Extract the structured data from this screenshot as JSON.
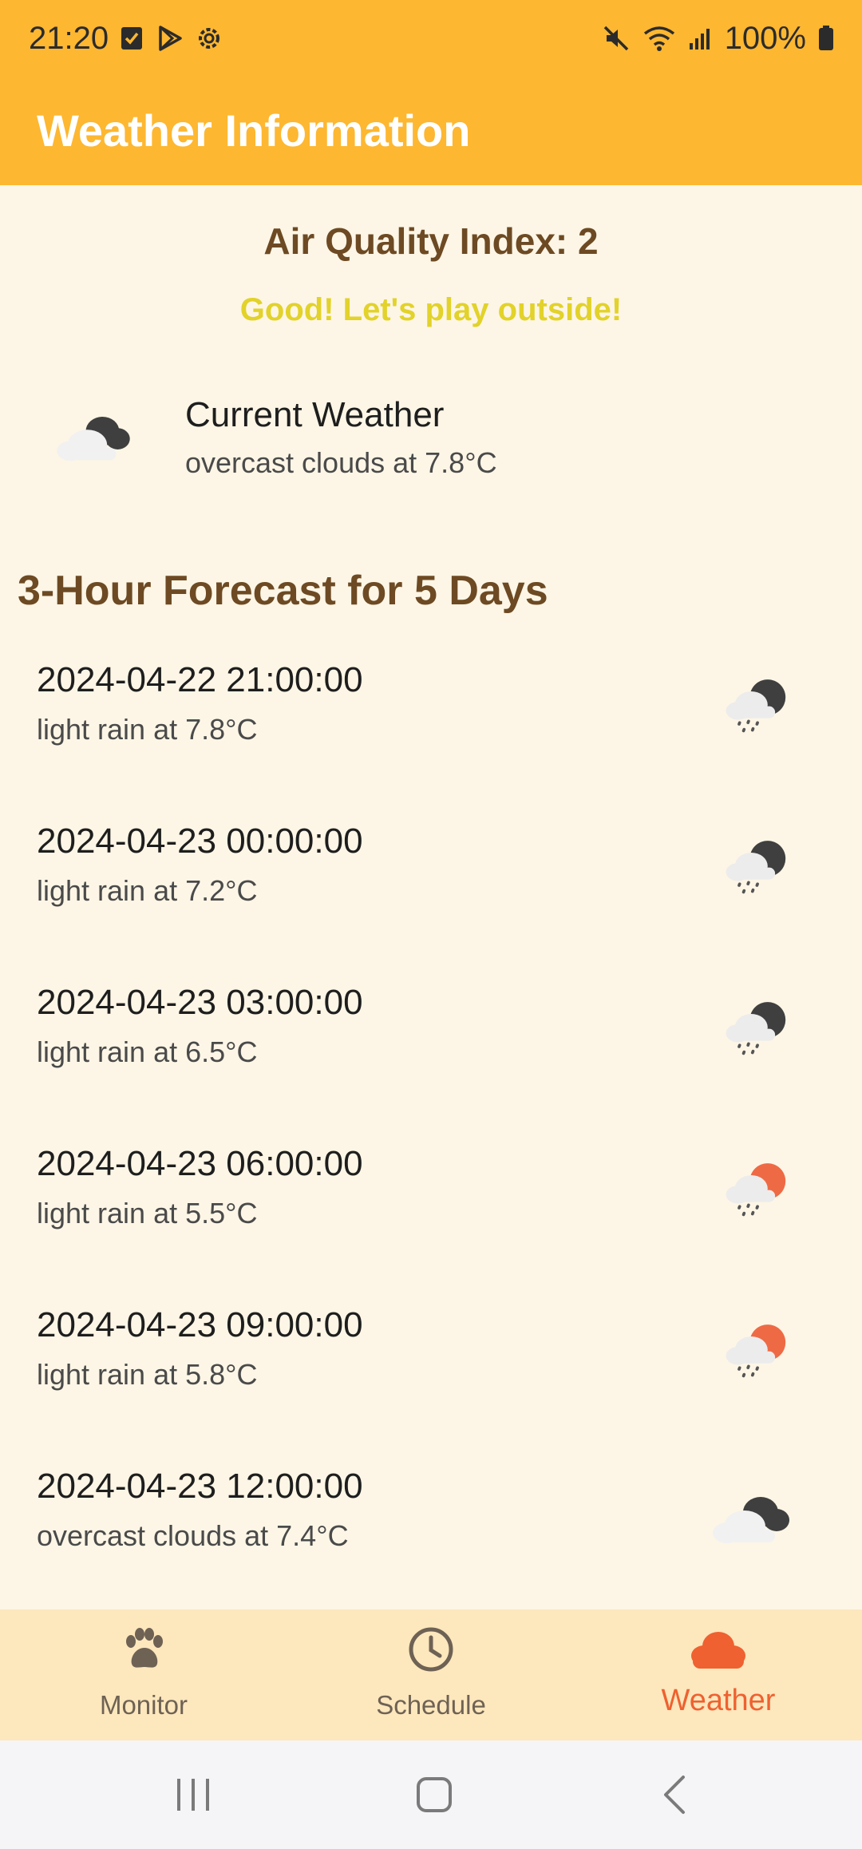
{
  "status_bar": {
    "time": "21:20",
    "battery_text": "100%",
    "left_icons": [
      "checkbox-icon",
      "play-store-icon",
      "settings-gear-icon"
    ],
    "right_icons": [
      "mute-icon",
      "wifi-icon",
      "signal-icon",
      "battery-icon"
    ]
  },
  "app_bar": {
    "title": "Weather Information"
  },
  "air_quality": {
    "title": "Air Quality Index: 2",
    "message": "Good! Let's play outside!"
  },
  "current_weather": {
    "title": "Current Weather",
    "description": "overcast clouds at 7.8°C",
    "icon": "overcast-clouds-icon"
  },
  "forecast": {
    "heading": "3-Hour Forecast for 5 Days",
    "items": [
      {
        "time": "2024-04-22 21:00:00",
        "description": "light rain at 7.8°C",
        "icon": "light-rain-night-icon"
      },
      {
        "time": "2024-04-23 00:00:00",
        "description": "light rain at 7.2°C",
        "icon": "light-rain-night-icon"
      },
      {
        "time": "2024-04-23 03:00:00",
        "description": "light rain at 6.5°C",
        "icon": "light-rain-night-icon"
      },
      {
        "time": "2024-04-23 06:00:00",
        "description": "light rain at 5.5°C",
        "icon": "light-rain-day-icon"
      },
      {
        "time": "2024-04-23 09:00:00",
        "description": "light rain at 5.8°C",
        "icon": "light-rain-day-icon"
      },
      {
        "time": "2024-04-23 12:00:00",
        "description": "overcast clouds at 7.4°C",
        "icon": "overcast-clouds-icon"
      }
    ]
  },
  "bottom_nav": {
    "items": [
      {
        "label": "Monitor",
        "icon": "paw-icon",
        "active": false
      },
      {
        "label": "Schedule",
        "icon": "clock-icon",
        "active": false
      },
      {
        "label": "Weather",
        "icon": "cloud-icon",
        "active": true
      }
    ]
  },
  "colors": {
    "app_bar": "#fdb731",
    "background": "#fdf6e6",
    "heading_brown": "#6d4a23",
    "good_yellow": "#e2d22a",
    "nav_background": "#fde7bd",
    "active_nav": "#ef6130",
    "inactive_nav": "#6e6254"
  }
}
